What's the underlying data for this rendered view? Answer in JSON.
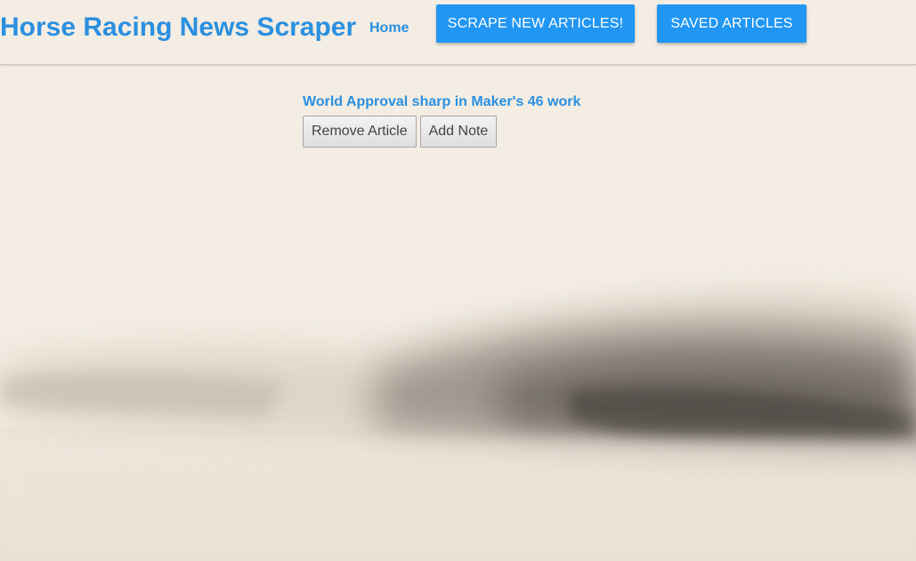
{
  "navbar": {
    "brand": "Horse Racing News Scraper",
    "home_label": "Home",
    "scrape_label": "SCRAPE NEW ARTICLES!",
    "saved_label": "SAVED ARTICLES"
  },
  "articles": [
    {
      "title": "World Approval sharp in Maker's 46 work",
      "remove_label": "Remove Article",
      "note_label": "Add Note"
    }
  ],
  "colors": {
    "accent": "#2196f3",
    "link": "#2b90e0",
    "background": "#f3ede3"
  }
}
